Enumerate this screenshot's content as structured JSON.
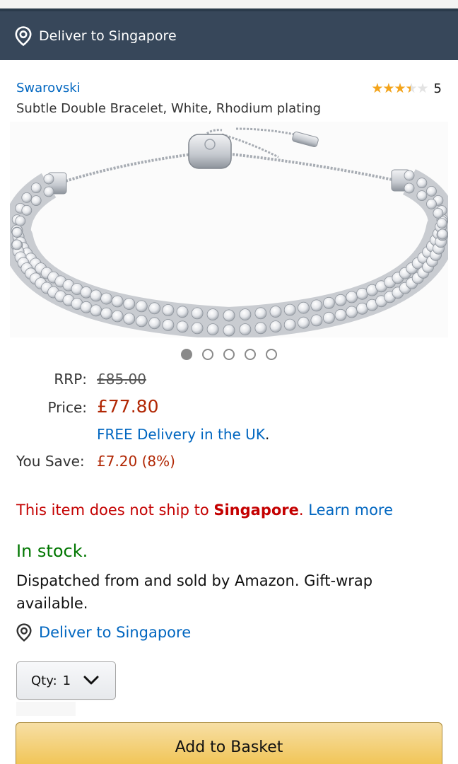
{
  "header": {
    "deliver_label": "Deliver to Singapore"
  },
  "product": {
    "brand": "Swarovski",
    "title": "Subtle Double Bracelet, White, Rhodium plating",
    "rating_value": 3.5,
    "rating_max": 5,
    "rating_count": "5",
    "image_alt": "Swarovski double row crystal tennis bracelet with slider clasp",
    "carousel": {
      "total": 5,
      "active": 1
    }
  },
  "pricing": {
    "rrp_label": "RRP:",
    "rrp_value": "£85.00",
    "price_label": "Price:",
    "price_value": "£77.80",
    "free_delivery": "FREE Delivery in the UK",
    "free_delivery_suffix": ".",
    "save_label": "You Save:",
    "save_value": "£7.20 (8%)"
  },
  "shipping": {
    "notice_prefix": "This item does not ship to ",
    "notice_location": "Singapore",
    "notice_suffix": ". ",
    "learn_more": "Learn more",
    "stock": "In stock.",
    "dispatch": "Dispatched from and sold by Amazon. Gift-wrap available.",
    "deliver_label": "Deliver to Singapore"
  },
  "purchase": {
    "qty_label": "Qty:",
    "qty_value": "1",
    "add_to_basket": "Add to Basket"
  },
  "colors": {
    "header_bg": "#37475a",
    "link": "#0066c0",
    "price": "#b12704",
    "warning": "#c40000",
    "stock": "#007600",
    "star": "#f4a41a",
    "button": "#f0c14b"
  }
}
